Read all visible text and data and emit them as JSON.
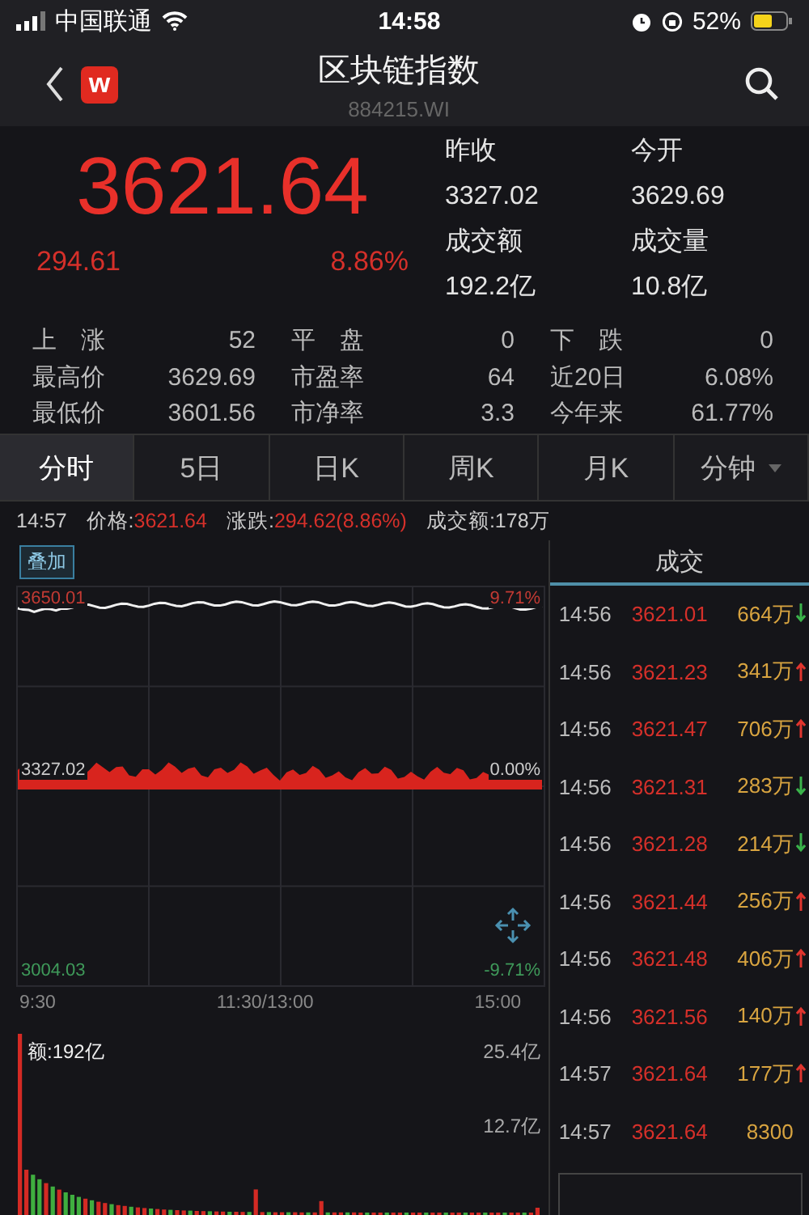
{
  "status_bar": {
    "carrier": "中国联通",
    "time": "14:58",
    "battery": "52%"
  },
  "header": {
    "app_badge": "w",
    "title": "区块链指数",
    "code": "884215.WI"
  },
  "quote": {
    "price": "3621.64",
    "change": "294.61",
    "change_pct": "8.86%",
    "fields": [
      {
        "label": "昨收",
        "value": "3327.02"
      },
      {
        "label": "今开",
        "value": "3629.69"
      },
      {
        "label": "成交额",
        "value": "192.2亿"
      },
      {
        "label": "成交量",
        "value": "10.8亿"
      }
    ]
  },
  "stats": [
    [
      {
        "label": "上　涨",
        "value": "52"
      },
      {
        "label": "平　盘",
        "value": "0"
      },
      {
        "label": "下　跌",
        "value": "0"
      }
    ],
    [
      {
        "label": "最高价",
        "value": "3629.69"
      },
      {
        "label": "市盈率",
        "value": "64"
      },
      {
        "label": "近20日",
        "value": "6.08%"
      }
    ],
    [
      {
        "label": "最低价",
        "value": "3601.56"
      },
      {
        "label": "市净率",
        "value": "3.3"
      },
      {
        "label": "今年来",
        "value": "61.77%"
      }
    ]
  ],
  "tabs": [
    {
      "label": "分时",
      "selected": true
    },
    {
      "label": "5日",
      "selected": false
    },
    {
      "label": "日K",
      "selected": false
    },
    {
      "label": "周K",
      "selected": false
    },
    {
      "label": "月K",
      "selected": false
    },
    {
      "label": "分钟",
      "selected": false,
      "dropdown": true
    }
  ],
  "info_line": {
    "time": "14:57",
    "price_label": "价格:",
    "price": "3621.64",
    "change_label": "涨跌:",
    "change": "294.62(8.86%)",
    "amount": "成交额:178万"
  },
  "price_chart": {
    "overlay_button": "叠加",
    "price_labels": [
      "3650.01",
      "3327.02",
      "3004.03"
    ],
    "pct_labels": [
      "9.71%",
      "0.00%",
      "-9.71%"
    ],
    "time_labels": [
      "9:30",
      "11:30/13:00",
      "15:00"
    ]
  },
  "volume_chart": {
    "title": "额:192亿",
    "scale_labels": [
      "25.4亿",
      "12.7亿"
    ]
  },
  "trades": {
    "title": "成交",
    "rows": [
      {
        "time": "14:56",
        "price": "3621.01",
        "volume": "664万",
        "kind": "down"
      },
      {
        "time": "14:56",
        "price": "3621.23",
        "volume": "341万",
        "kind": "up"
      },
      {
        "time": "14:56",
        "price": "3621.47",
        "volume": "706万",
        "kind": "up"
      },
      {
        "time": "14:56",
        "price": "3621.31",
        "volume": "283万",
        "kind": "down"
      },
      {
        "time": "14:56",
        "price": "3621.28",
        "volume": "214万",
        "kind": "down"
      },
      {
        "time": "14:56",
        "price": "3621.44",
        "volume": "256万",
        "kind": "up"
      },
      {
        "time": "14:56",
        "price": "3621.48",
        "volume": "406万",
        "kind": "up"
      },
      {
        "time": "14:56",
        "price": "3621.56",
        "volume": "140万",
        "kind": "up"
      },
      {
        "time": "14:57",
        "price": "3621.64",
        "volume": "177万",
        "kind": "up"
      },
      {
        "time": "14:57",
        "price": "3621.64",
        "volume": "8300",
        "kind": "plain"
      }
    ]
  }
}
